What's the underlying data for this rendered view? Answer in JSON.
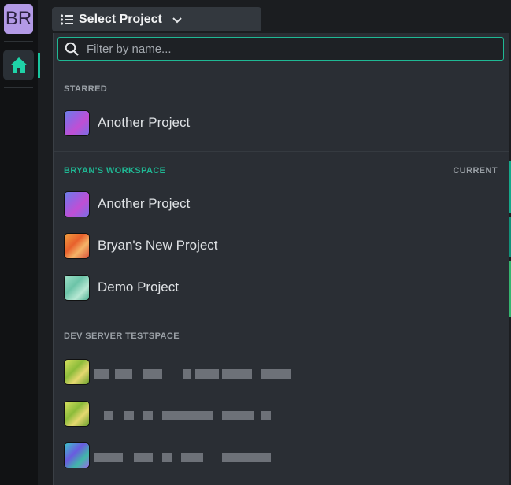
{
  "sidebar": {
    "avatar_initials": "BR",
    "home_icon": "home-icon"
  },
  "header": {
    "title": "Select Project",
    "list_icon": "list-icon",
    "chevron_icon": "chevron-down-icon"
  },
  "dropdown": {
    "search": {
      "placeholder": "Filter by name...",
      "value": ""
    },
    "sections": [
      {
        "header": "STARRED",
        "items": [
          {
            "name": "Another Project",
            "thumb": "purple"
          }
        ]
      },
      {
        "header": "BRYAN'S WORKSPACE",
        "right_label": "CURRENT",
        "items": [
          {
            "name": "Another Project",
            "thumb": "purple"
          },
          {
            "name": "Bryan's New Project",
            "thumb": "orange"
          },
          {
            "name": "Demo Project",
            "thumb": "teal"
          }
        ]
      },
      {
        "header": "DEV SERVER TESTSPACE",
        "items": [
          {
            "name": "",
            "thumb": "lime",
            "blurred": true
          },
          {
            "name": "",
            "thumb": "lime",
            "blurred": true
          },
          {
            "name": "",
            "thumb": "aqua",
            "blurred": true
          }
        ]
      }
    ]
  },
  "colors": {
    "accent": "#1fb894",
    "panel_bg": "#2a2e34",
    "avatar_bg": "#b39ae6"
  }
}
